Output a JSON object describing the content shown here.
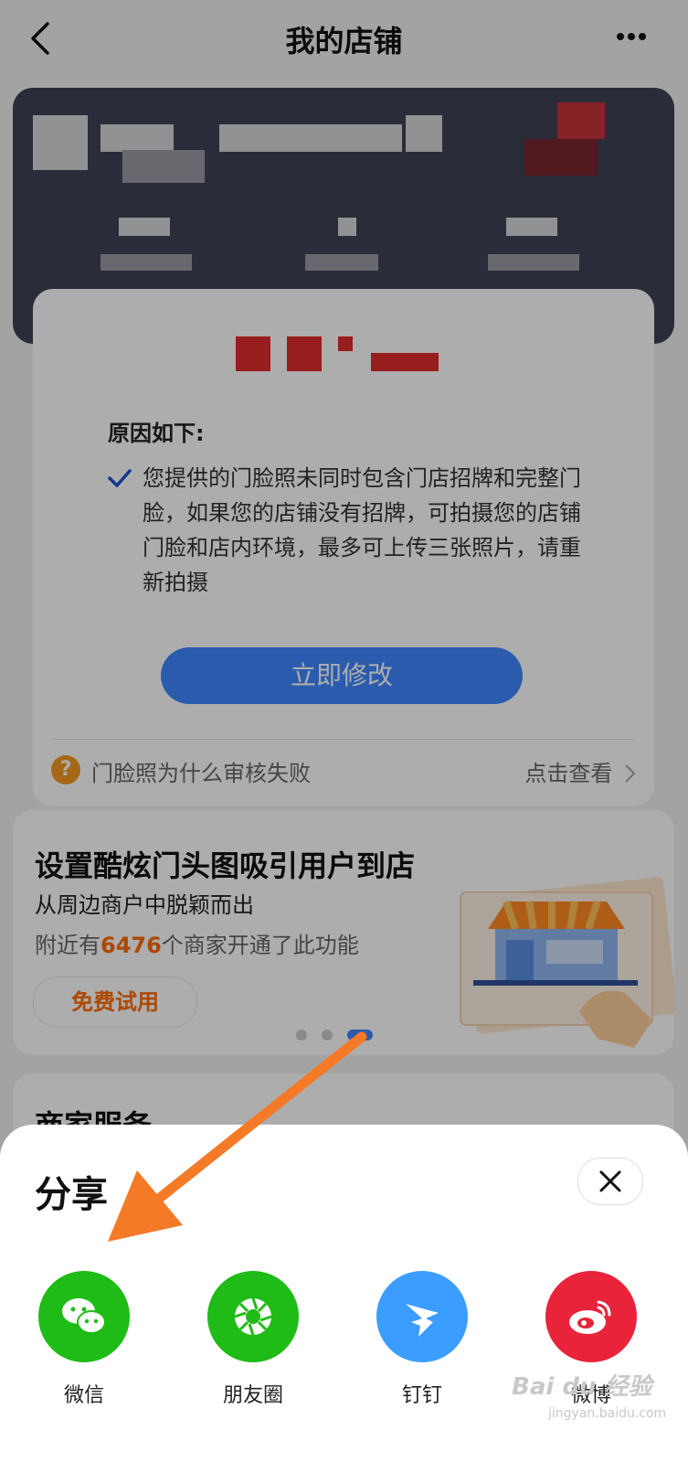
{
  "nav": {
    "title": "我的店铺"
  },
  "audit": {
    "reason_title": "原因如下:",
    "reason_text": "您提供的门脸照未同时包含门店招牌和完整门脸，如果您的店铺没有招牌，可拍摄您的店铺门脸和店内环境，最多可上传三张照片，请重新拍摄",
    "fix_button": "立即修改",
    "help_text": "门脸照为什么审核失败",
    "help_link": "点击查看",
    "help_icon": "?"
  },
  "promo": {
    "title": "设置酷炫门头图吸引用户到店",
    "subtitle": "从周边商户中脱颖而出",
    "note_prefix": "附近有",
    "note_number": "6476",
    "note_suffix": "个商家开通了此功能",
    "trial_button": "免费试用",
    "carousel_total": 3,
    "carousel_active_index": 2
  },
  "service": {
    "title": "商家服务"
  },
  "share_sheet": {
    "title": "分享",
    "items": [
      {
        "label": "微信",
        "icon": "wechat-icon",
        "color": "#1fbb16"
      },
      {
        "label": "朋友圈",
        "icon": "moments-icon",
        "color": "#1fbb16"
      },
      {
        "label": "钉钉",
        "icon": "dingtalk-icon",
        "color": "#3a9dff"
      },
      {
        "label": "微博",
        "icon": "weibo-icon",
        "color": "#e8233a"
      }
    ]
  },
  "watermark": {
    "text": "Bai du 经验",
    "sub": "jingyan.baidu.com"
  },
  "colors": {
    "accent": "#3f87ff",
    "orange": "#ff6a00",
    "banner_bg": "#3f4354",
    "annotation_arrow": "#f47a28"
  }
}
